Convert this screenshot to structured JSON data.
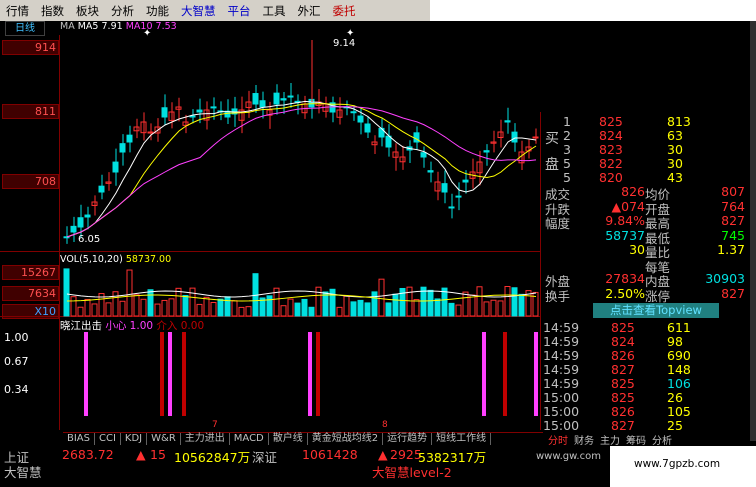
{
  "menu": [
    "行情",
    "指数",
    "板块",
    "分析",
    "功能",
    "大智慧",
    "平台",
    "工具",
    "外汇",
    "委托"
  ],
  "period_tab": "日线",
  "ma_legend": {
    "ma": "MA",
    "ma5_label": "MA5",
    "ma5": "7.91",
    "ma10_label": "MA10",
    "ma10": "7.53"
  },
  "price_axis": [
    "914",
    "811",
    "708"
  ],
  "price_high_label": "9.14",
  "price_low_label": "6.05",
  "vol_legend": {
    "label": "VOL(5,10,20)",
    "value": "58737.00"
  },
  "vol_axis": [
    "15267",
    "7634",
    "X10"
  ],
  "signal": {
    "title": "晓江出击",
    "l1": "小心 1.00",
    "l2": "介入 0.00",
    "axis": [
      "1.00",
      "0.67",
      "0.34"
    ]
  },
  "x_labels": [
    "7",
    "8"
  ],
  "orderbook": {
    "side_buy": "买",
    "side_panel": "盘",
    "levels": [
      {
        "n": "1",
        "price": "825",
        "vol": "813"
      },
      {
        "n": "2",
        "price": "824",
        "vol": "63"
      },
      {
        "n": "3",
        "price": "823",
        "vol": "30"
      },
      {
        "n": "5",
        "price": "822",
        "vol": "30"
      },
      {
        "n": "5",
        "price": "820",
        "vol": "43"
      }
    ]
  },
  "stats": [
    {
      "l": "成交",
      "v": "826",
      "l2": "均价",
      "v2": "807"
    },
    {
      "l": "升跌",
      "v": "▲074",
      "l2": "开盘",
      "v2": "764"
    },
    {
      "l": "幅度",
      "v": "9.84%",
      "l2": "最高",
      "v2": "827"
    },
    {
      "l": "",
      "v": "58737",
      "l2": "最低",
      "v2": "745"
    },
    {
      "l": "",
      "v": "30",
      "l2": "量比",
      "v2": "1.37"
    },
    {
      "l": "",
      "v": "",
      "l2": "每笔",
      "v2": ""
    },
    {
      "l": "外盘",
      "v": "27834",
      "l2": "内盘",
      "v2": "30903"
    },
    {
      "l": "换手",
      "v": "2.50%",
      "l2": "涨停",
      "v2": "827"
    }
  ],
  "topview_btn": "点击查看Topview",
  "ticks": [
    {
      "t": "14:59",
      "p": "825",
      "v": "611"
    },
    {
      "t": "14:59",
      "p": "824",
      "v": "98"
    },
    {
      "t": "14:59",
      "p": "826",
      "v": "690"
    },
    {
      "t": "14:59",
      "p": "827",
      "v": "148"
    },
    {
      "t": "14:59",
      "p": "825",
      "v": "106"
    },
    {
      "t": "15:00",
      "p": "825",
      "v": "26"
    },
    {
      "t": "15:00",
      "p": "826",
      "v": "105"
    },
    {
      "t": "15:00",
      "p": "827",
      "v": "25"
    }
  ],
  "indicator_tabs": [
    "BIAS",
    "CCI",
    "KDJ",
    "W&R",
    "主力进出",
    "MACD",
    "散户线",
    "黄金短战均线2",
    "运行趋势",
    "短线工作线"
  ],
  "right_tabs": [
    "分时",
    "财务",
    "主力",
    "筹码",
    "分析"
  ],
  "status": {
    "sh_label": "上证",
    "sh_value": "2683.72",
    "sh_change": "15",
    "sh_amount": "10562847万",
    "sz_label": "深证",
    "sz_value": "1061428",
    "sz_change": "2925",
    "sz_amount": "5382317万",
    "brand": "大智慧",
    "level2": "大智慧level-2",
    "site": "www.gw.com"
  },
  "watermark": "www.7gpzb.com",
  "colors": {
    "up": "#ff3030",
    "down": "#00e0e0",
    "ma5": "#ffffff",
    "ma10": "#ffff00",
    "ma20": "#ff40ff",
    "axis": "#800000",
    "bg": "#000000"
  }
}
